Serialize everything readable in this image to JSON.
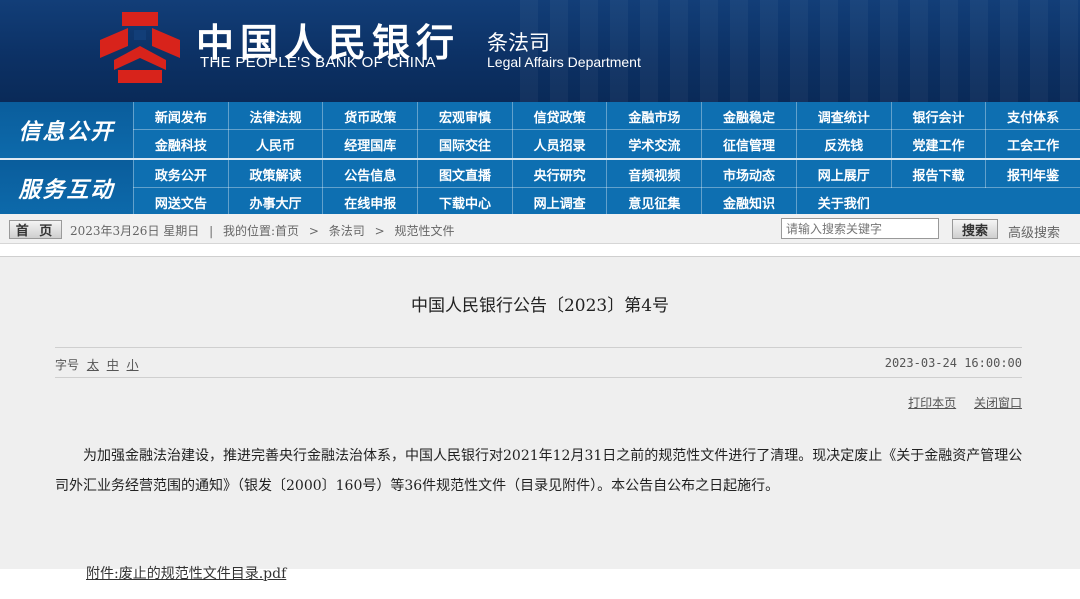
{
  "header": {
    "bank_name_cn": "中国人民银行",
    "bank_name_en": "THE PEOPLE'S BANK OF CHINA",
    "dept_cn": "条法司",
    "dept_en": "Legal Affairs Department",
    "logo_icon": "pboc-logo-icon",
    "colors": {
      "banner": "#0c3165",
      "nav": "#0e6fb1",
      "logo_red": "#d8231b"
    }
  },
  "nav": {
    "section1_label": "信息公开",
    "section1_items": [
      "新闻发布",
      "法律法规",
      "货币政策",
      "宏观审慎",
      "信贷政策",
      "金融市场",
      "金融稳定",
      "调查统计",
      "银行会计",
      "支付体系",
      "金融科技",
      "人民币",
      "经理国库",
      "国际交往",
      "人员招录",
      "学术交流",
      "征信管理",
      "反洗钱",
      "党建工作",
      "工会工作"
    ],
    "section2_label": "服务互动",
    "section2_items": [
      "政务公开",
      "政策解读",
      "公告信息",
      "图文直播",
      "央行研究",
      "音频视频",
      "市场动态",
      "网上展厅",
      "报告下载",
      "报刊年鉴",
      "网送文告",
      "办事大厅",
      "在线申报",
      "下载中心",
      "网上调查",
      "意见征集",
      "金融知识",
      "关于我们"
    ]
  },
  "breadcrumb": {
    "home_label": "首 页",
    "date": "2023年3月26日 星期日",
    "sep": "|",
    "location_label": "我的位置:首页",
    "arrow": ">",
    "level1": "条法司",
    "level2": "规范性文件"
  },
  "search": {
    "placeholder": "请输入搜索关键字",
    "button_label": "搜索",
    "advanced_label": "高级搜索"
  },
  "article": {
    "title": "中国人民银行公告〔2023〕第4号",
    "font_size_label": "字号",
    "font_large": "太",
    "font_medium": "中",
    "font_small": "小",
    "date": "2023-03-24 16:00:00",
    "print_label": "打印本页",
    "close_label": "关闭窗口",
    "body": "为加强金融法治建设，推进完善央行金融法治体系，中国人民银行对2021年12月31日之前的规范性文件进行了清理。现决定废止《关于金融资产管理公司外汇业务经营范围的通知》（银发〔2000〕160号）等36件规范性文件（目录见附件）。本公告自公布之日起施行。",
    "attachment": "附件:废止的规范性文件目录.pdf"
  }
}
